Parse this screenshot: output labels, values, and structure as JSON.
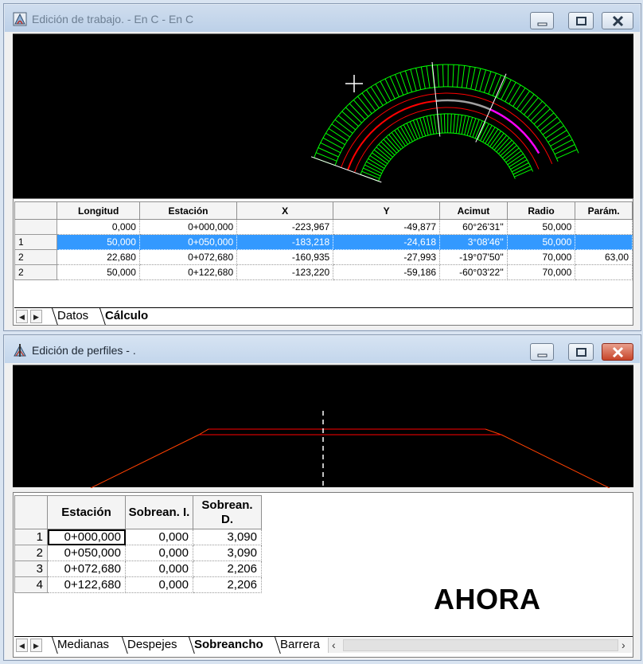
{
  "work_window": {
    "title": "Edición de trabajo. - En C - En C",
    "columns": [
      "Longitud",
      "Estación",
      "X",
      "Y",
      "Acimut",
      "Radio",
      "Parám."
    ],
    "rows": [
      {
        "id": "",
        "cells": [
          "0,000",
          "0+000,000",
          "-223,967",
          "-49,877",
          "60°26'31''",
          "50,000",
          ""
        ]
      },
      {
        "id": "1",
        "cells": [
          "50,000",
          "0+050,000",
          "-183,218",
          "-24,618",
          "3°08'46''",
          "50,000",
          ""
        ]
      },
      {
        "id": "2",
        "cells": [
          "22,680",
          "0+072,680",
          "-160,935",
          "-27,993",
          "-19°07'50''",
          "70,000",
          "63,00"
        ]
      },
      {
        "id": "2",
        "cells": [
          "50,000",
          "0+122,680",
          "-123,220",
          "-59,186",
          "-60°03'22''",
          "70,000",
          ""
        ]
      }
    ],
    "selected_row": 1,
    "tabs": [
      "Datos",
      "Cálculo"
    ],
    "active_tab": 1
  },
  "profile_window": {
    "title": "Edición de perfiles - .",
    "columns": [
      "Estación",
      "Sobrean. I.",
      "Sobrean. D."
    ],
    "rows": [
      {
        "id": "1",
        "cells": [
          "0+000,000",
          "0,000",
          "3,090"
        ]
      },
      {
        "id": "2",
        "cells": [
          "0+050,000",
          "0,000",
          "3,090"
        ]
      },
      {
        "id": "3",
        "cells": [
          "0+072,680",
          "0,000",
          "2,206"
        ]
      },
      {
        "id": "4",
        "cells": [
          "0+122,680",
          "0,000",
          "2,206"
        ]
      }
    ],
    "tabs": [
      "Medianas",
      "Despejes",
      "Sobreancho",
      "Barrera"
    ],
    "active_tab": 2,
    "stamp": "AHORA"
  },
  "window_controls": [
    "minimize-icon",
    "maximize-icon",
    "close-icon"
  ],
  "colors": {
    "canvas": "#000000",
    "road_edge": "#00ff00",
    "offset_line": "#ff0000",
    "axis_highlight": "#ff00ff",
    "axis_grey": "#a0a0a0",
    "section_line": "#ff4000",
    "selection": "#3399ff",
    "close_button": "#c7452a"
  }
}
